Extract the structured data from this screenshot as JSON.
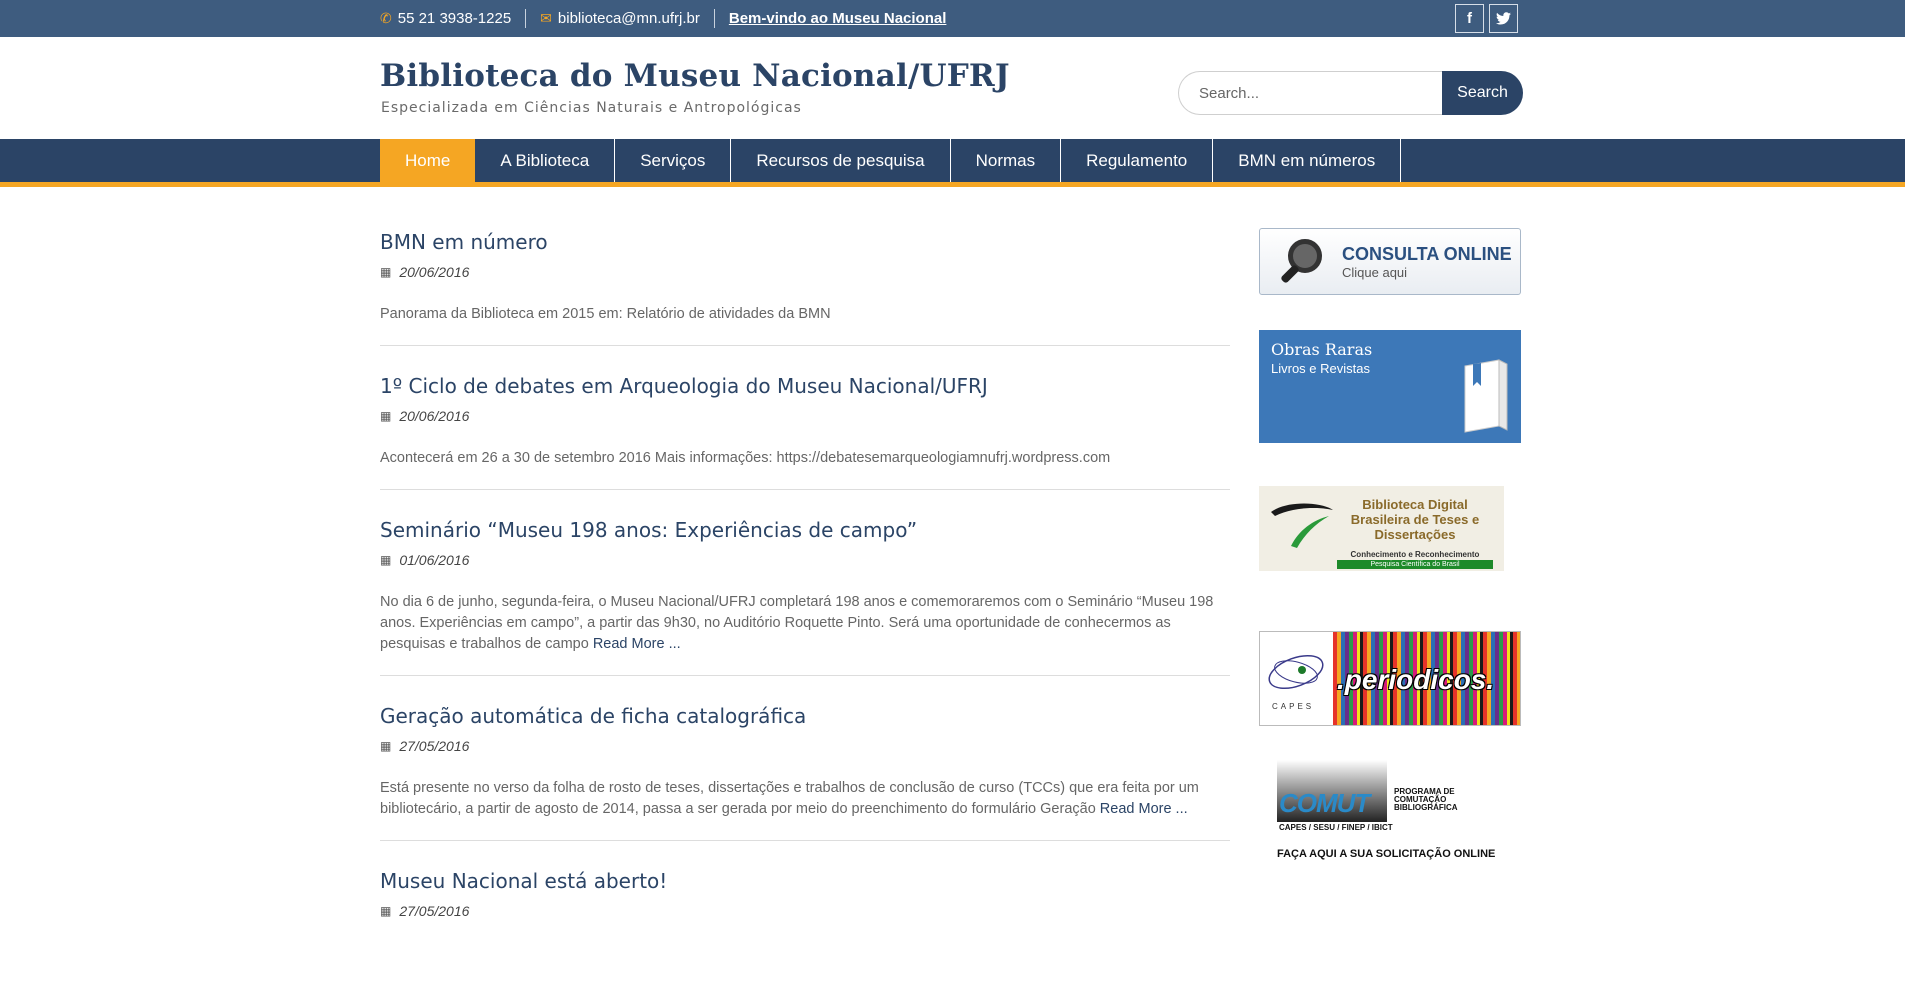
{
  "topbar": {
    "phone": "55 21 3938-1225",
    "email": "biblioteca@mn.ufrj.br",
    "welcome": "Bem-vindo ao Museu Nacional",
    "facebook": "f",
    "twitter": "t"
  },
  "header": {
    "title": "Biblioteca do Museu Nacional/UFRJ",
    "description": "Especializada em Ciências Naturais e Antropológicas"
  },
  "search": {
    "placeholder": "Search...",
    "button": "Search"
  },
  "nav": {
    "items": [
      {
        "label": "Home"
      },
      {
        "label": "A Biblioteca"
      },
      {
        "label": "Serviços"
      },
      {
        "label": "Recursos de pesquisa"
      },
      {
        "label": "Normas"
      },
      {
        "label": "Regulamento"
      },
      {
        "label": "BMN em números"
      }
    ]
  },
  "posts": [
    {
      "title": "BMN em número",
      "date": "20/06/2016",
      "excerpt": "Panorama da Biblioteca em 2015 em: Relatório de atividades da BMN",
      "read_more": ""
    },
    {
      "title": "1º Ciclo de debates em Arqueologia do Museu Nacional/UFRJ",
      "date": "20/06/2016",
      "excerpt": "Acontecerá em 26 a 30 de setembro 2016   Mais informações: https://debatesemarqueologiamnufrj.wordpress.com",
      "read_more": ""
    },
    {
      "title": "Seminário “Museu 198 anos: Experiências de campo”",
      "date": "01/06/2016",
      "excerpt": "No dia 6 de junho, segunda-feira, o Museu Nacional/UFRJ completará 198 anos e comemoraremos com o Seminário  “Museu 198 anos. Experiências em campo”, a partir das 9h30, no Auditório Roquette Pinto. Será uma oportunidade de conhecermos as pesquisas e trabalhos de campo ",
      "read_more": "Read More ..."
    },
    {
      "title": "Geração automática de ficha catalográfica",
      "date": "27/05/2016",
      "excerpt": "Está presente no verso da folha de rosto de teses, dissertações e trabalhos de conclusão de curso (TCCs) que era feita por um bibliotecário, a partir de agosto de 2014, passa a ser gerada por meio do preenchimento do formulário Geração ",
      "read_more": "Read More ..."
    },
    {
      "title": "Museu Nacional está aberto!",
      "date": "27/05/2016",
      "excerpt": "",
      "read_more": ""
    }
  ],
  "sidebar": {
    "consulta_title": "CONSULTA ONLINE",
    "consulta_sub": "Clique aqui",
    "obras_title": "Obras Raras",
    "obras_sub": "Livros e Revistas",
    "bdtd_title": "Biblioteca Digital Brasileira de Teses e Dissertações",
    "bdtd_tagline": "Conhecimento e Reconhecimento",
    "bdtd_bar": "Pesquisa Científica do Brasil",
    "capes_label": "CAPES",
    "periodicos": ".periodicos.",
    "comut_word": "COMUT",
    "comut_program": "PROGRAMA DE COMUTAÇÃO BIBLIOGRÁFICA",
    "comut_partners": "CAPES / SESU / FINEP / IBICT",
    "comut_cta": "FAÇA AQUI A SUA SOLICITAÇÃO ONLINE"
  }
}
